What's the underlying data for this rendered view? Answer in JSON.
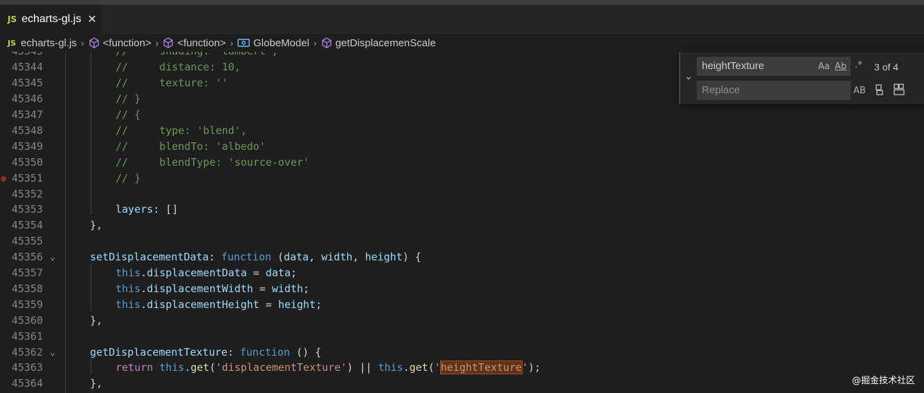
{
  "tab": {
    "badge": "JS",
    "title": "echarts-gl.js",
    "close": "✕"
  },
  "breadcrumb": {
    "file_badge": "JS",
    "file": "echarts-gl.js",
    "items": [
      "<function>",
      "<function>",
      "GlobeModel",
      "getDisplacemenScale"
    ],
    "icons": [
      "cube-icon",
      "cube-icon",
      "field-icon",
      "cube-icon"
    ]
  },
  "code": {
    "lines": [
      {
        "num": "45344",
        "text": "//     distance: 10,"
      },
      {
        "num": "45345",
        "text": "//     texture: ''"
      },
      {
        "num": "45346",
        "text": "// }"
      },
      {
        "num": "45347",
        "text": "// {"
      },
      {
        "num": "45348",
        "text": "//     type: 'blend',"
      },
      {
        "num": "45349",
        "text": "//     blendTo: 'albedo'"
      },
      {
        "num": "45350",
        "text": "//     blendType: 'source-over'"
      },
      {
        "num": "45351",
        "text": "// }"
      },
      {
        "num": "45352",
        "text": ""
      },
      {
        "num": "45353",
        "text": "layers: []"
      },
      {
        "num": "45354",
        "text": "},"
      },
      {
        "num": "45355",
        "text": ""
      },
      {
        "num": "45356",
        "text": "setDisplacementData: function (data, width, height) {"
      },
      {
        "num": "45357",
        "text": "this.displacementData = data;"
      },
      {
        "num": "45358",
        "text": "this.displacementWidth = width;"
      },
      {
        "num": "45359",
        "text": "this.displacementHeight = height;"
      },
      {
        "num": "45360",
        "text": "},"
      },
      {
        "num": "45361",
        "text": ""
      },
      {
        "num": "45362",
        "text": "getDisplacementTexture: function () {"
      },
      {
        "num": "45363",
        "text": "return this.get('displacementTexture') || this.get('heightTexture');"
      },
      {
        "num": "45364",
        "text": "},"
      }
    ]
  },
  "find": {
    "query": "heightTexture",
    "replace_placeholder": "Replace",
    "count": "3 of 4",
    "match_case": "Aa",
    "whole_word": "Ab",
    "regex": ".*",
    "preserve_case": "AB"
  },
  "watermark": "@掘金技术社区",
  "colors": {
    "comment": "#6a9955",
    "keyword": "#569cd6",
    "property": "#9cdcfe",
    "string": "#ce9178",
    "background": "#1e1e1e"
  }
}
